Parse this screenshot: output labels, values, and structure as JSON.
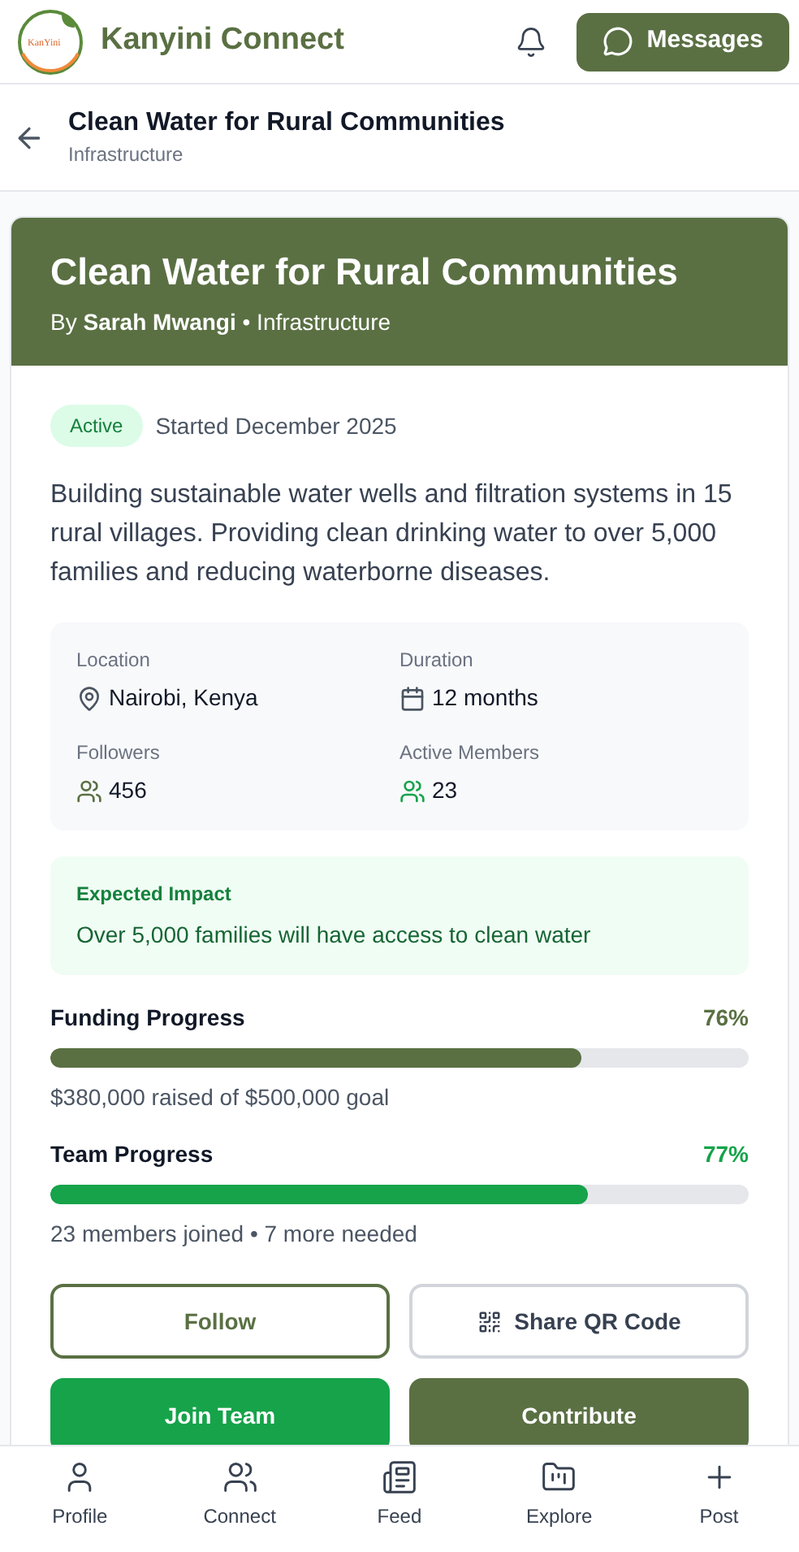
{
  "header": {
    "logo_text": "KanYini",
    "app_name": "Kanyini Connect",
    "messages_button": "Messages"
  },
  "subheader": {
    "title": "Clean Water for Rural Communities",
    "subtitle": "Infrastructure"
  },
  "project": {
    "title": "Clean Water for Rural Communities",
    "byline": "By **Sarah Mwangi** • Infrastructure",
    "status": "Active",
    "started": "Started December 2025",
    "description": "Building sustainable water wells and filtration systems in 15 rural villages. Providing clean drinking water to over 5,000 families and reducing waterborne diseases.",
    "stats": [
      {
        "label": "Location",
        "value": "Nairobi, Kenya",
        "kind": "location",
        "color": "#4b5563"
      },
      {
        "label": "Duration",
        "value": "12 months",
        "kind": "duration",
        "color": "#4b5563"
      },
      {
        "label": "Followers",
        "value": "456",
        "kind": "people",
        "color": "#5a7043"
      },
      {
        "label": "Active Members",
        "value": "23",
        "kind": "people",
        "color": "#16a34a"
      }
    ],
    "impact": {
      "title": "Expected Impact",
      "text": "Over 5,000 families will have access to clean water"
    },
    "progress": [
      {
        "label": "Funding Progress",
        "percent": "76%",
        "level": 0.76,
        "note": "$380,000 raised of $500,000 goal",
        "color": "#5a7043"
      },
      {
        "label": "Team Progress",
        "percent": "77%",
        "level": 0.77,
        "note": "23 members joined • 7 more needed",
        "color": "#16a34a"
      }
    ],
    "buttons": [
      {
        "label": "Follow",
        "kind": "outline",
        "color": "#5a7043"
      },
      {
        "label": "Share QR Code",
        "kind": "share",
        "color": "#d1d5db"
      },
      {
        "label": "Join Team",
        "kind": "solid",
        "color": "#16a34a"
      },
      {
        "label": "Contribute",
        "kind": "solid",
        "color": "#5a7043"
      }
    ]
  },
  "nav": [
    {
      "label": "Profile",
      "kind": "profile"
    },
    {
      "label": "Connect",
      "kind": "connect"
    },
    {
      "label": "Feed",
      "kind": "feed"
    },
    {
      "label": "Explore",
      "kind": "explore"
    },
    {
      "label": "Post",
      "kind": "post"
    }
  ]
}
